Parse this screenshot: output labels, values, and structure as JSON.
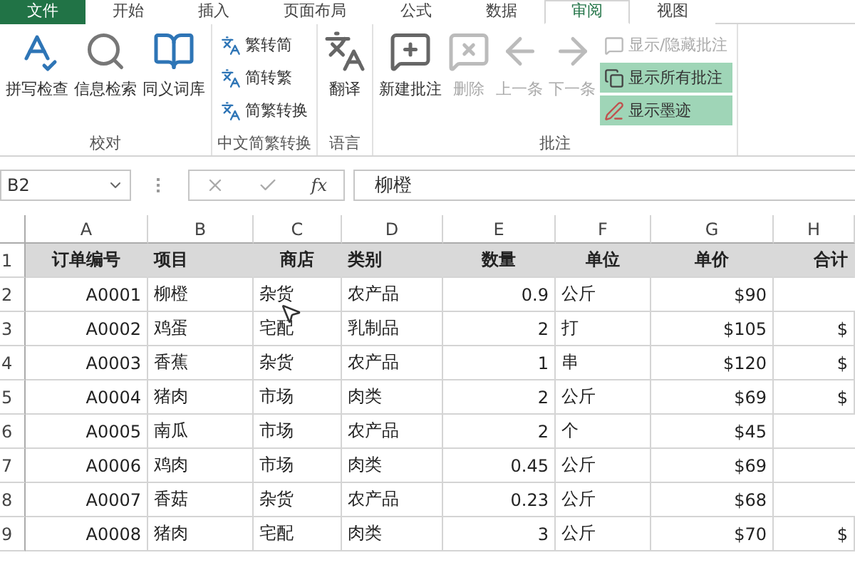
{
  "tabs": [
    {
      "label": "文件",
      "kind": "file",
      "selected": false
    },
    {
      "label": "开始",
      "kind": "tab",
      "selected": false
    },
    {
      "label": "插入",
      "kind": "tab",
      "selected": false
    },
    {
      "label": "页面布局",
      "kind": "tab",
      "selected": false
    },
    {
      "label": "公式",
      "kind": "tab",
      "selected": false
    },
    {
      "label": "数据",
      "kind": "tab",
      "selected": false
    },
    {
      "label": "审阅",
      "kind": "tab",
      "selected": true
    },
    {
      "label": "视图",
      "kind": "tab",
      "selected": false
    }
  ],
  "ribbon": {
    "groups": [
      {
        "label": "校对",
        "buttons": [
          {
            "label": "拼写检查",
            "kind": "large",
            "disabled": false
          },
          {
            "label": "信息检索",
            "kind": "large",
            "disabled": false
          },
          {
            "label": "同义词库",
            "kind": "large",
            "disabled": false
          }
        ]
      },
      {
        "label": "中文简繁转换",
        "buttons": [
          {
            "label": "繁转简",
            "kind": "small",
            "disabled": false
          },
          {
            "label": "简转繁",
            "kind": "small",
            "disabled": false
          },
          {
            "label": "简繁转换",
            "kind": "small",
            "disabled": false
          }
        ]
      },
      {
        "label": "语言",
        "buttons": [
          {
            "label": "翻译",
            "kind": "large",
            "disabled": false
          }
        ]
      },
      {
        "label": "批注",
        "buttons": [
          {
            "label": "新建批注",
            "kind": "large",
            "disabled": false
          },
          {
            "label": "删除",
            "kind": "large",
            "disabled": true
          },
          {
            "label": "上一条",
            "kind": "large",
            "disabled": true
          },
          {
            "label": "下一条",
            "kind": "large",
            "disabled": true
          },
          {
            "label": "显示/隐藏批注",
            "kind": "small",
            "disabled": true,
            "on": false
          },
          {
            "label": "显示所有批注",
            "kind": "small",
            "disabled": false,
            "on": true
          },
          {
            "label": "显示墨迹",
            "kind": "small",
            "disabled": false,
            "on": true
          }
        ]
      }
    ]
  },
  "formula_bar": {
    "name_box": "B2",
    "fx": "fx",
    "value": "柳橙"
  },
  "sheet": {
    "columns": [
      "A",
      "B",
      "C",
      "D",
      "E",
      "F",
      "G",
      "H"
    ],
    "rows": [
      {
        "number": "1",
        "kind": "header",
        "cells": [
          "订单编号",
          "项目",
          "商店",
          "类别",
          "数量",
          "单位",
          "单价",
          "合计"
        ]
      },
      {
        "number": "2",
        "kind": "data",
        "cells": [
          "A0001",
          "柳橙",
          "杂货",
          "农产品",
          "0.9",
          "公斤",
          "$90"
        ]
      },
      {
        "number": "3",
        "kind": "data",
        "cells": [
          "A0002",
          "鸡蛋",
          "宅配",
          "乳制品",
          "2",
          "打",
          "$105",
          "$"
        ]
      },
      {
        "number": "4",
        "kind": "data",
        "cells": [
          "A0003",
          "香蕉",
          "杂货",
          "农产品",
          "1",
          "串",
          "$120",
          "$"
        ]
      },
      {
        "number": "5",
        "kind": "data",
        "cells": [
          "A0004",
          "猪肉",
          "市场",
          "肉类",
          "2",
          "公斤",
          "$69",
          "$"
        ]
      },
      {
        "number": "6",
        "kind": "data",
        "cells": [
          "A0005",
          "南瓜",
          "市场",
          "农产品",
          "2",
          "个",
          "$45"
        ]
      },
      {
        "number": "7",
        "kind": "data",
        "cells": [
          "A0006",
          "鸡肉",
          "市场",
          "肉类",
          "0.45",
          "公斤",
          "$69"
        ]
      },
      {
        "number": "8",
        "kind": "data",
        "cells": [
          "A0007",
          "香菇",
          "杂货",
          "农产品",
          "0.23",
          "公斤",
          "$68"
        ]
      },
      {
        "number": "9",
        "kind": "data",
        "cells": [
          "A0008",
          "猪肉",
          "宅配",
          "肉类",
          "3",
          "公斤",
          "$70",
          "$"
        ]
      }
    ]
  }
}
